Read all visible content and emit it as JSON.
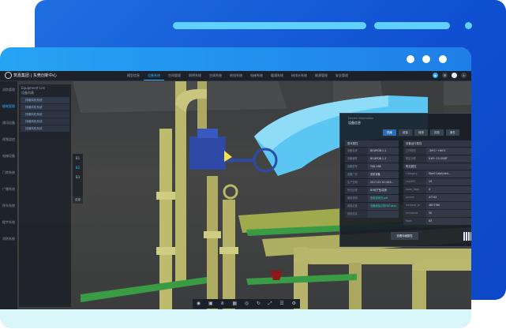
{
  "colors": {
    "back_card": "#1f6fe0",
    "front_top": "#26a4f4",
    "accent": "#2fb6ff",
    "teal_link": "#2fd3b0",
    "pipe_yellow": "#b9b76a",
    "pipe_blue": "#5cc6f2",
    "valve_blue": "#2f4aa6"
  },
  "header": {
    "brand": "筑嘉集团 | 东莞创新中心"
  },
  "nav": {
    "items": [
      "模型信息",
      "设备系统",
      "空间管理",
      "照明系统",
      "空调系统",
      "给排系统",
      "电梯系统",
      "暖通系统",
      "给排水系统",
      "能源管理",
      "安全管理"
    ],
    "active_index": 1
  },
  "toolbar_icons": [
    "notification-icon",
    "message-icon",
    "user-icon",
    "search-icon"
  ],
  "sidebar": {
    "items": [
      "消防管理",
      "能耗管理",
      "通讯设备",
      "视频监控",
      "电梯设备",
      "门禁系统",
      "广播系统",
      "停车系统",
      "楼宇系统",
      "消防系统"
    ],
    "active_index": 1
  },
  "tree": {
    "title": "Equipment List",
    "subtitle": "设备列表",
    "items": [
      "排烟风机系统",
      "排烟风机系统",
      "排烟风机系统",
      "排烟风机系统",
      "排烟风机系统"
    ],
    "selected_index": 0
  },
  "floor": {
    "items": [
      "B1",
      "B2",
      "B3"
    ],
    "active_index": 1,
    "all_label": "全部"
  },
  "info": {
    "subtitle": "Device information",
    "title": "设备信息",
    "tabs": [
      "档案",
      "维保",
      "维修",
      "巡检",
      "备件"
    ],
    "active_tab": 0,
    "left_heading": "基本属性",
    "left_rows": [
      {
        "k": "设备名称",
        "v": "B3-BFDB-1-1",
        "link": false
      },
      {
        "k": "设备编号",
        "v": "B3-BFDB-1-1",
        "link": false
      },
      {
        "k": "设备型号",
        "v": "TAD-168",
        "link": false
      },
      {
        "k": "设备厂商",
        "v": "安防设备",
        "link": false
      },
      {
        "k": "生产日期",
        "v": "2017-03-30 08:0…",
        "link": false
      },
      {
        "k": "所在区域",
        "v": "B3地下室/泵房",
        "link": false
      },
      {
        "k": "使用说明",
        "v": "查看说明书.pdf",
        "link": true
      },
      {
        "k": "维保记录",
        "v": "设备维保记录PDF.docx",
        "link": true
      },
      {
        "k": "其他信息",
        "v": "",
        "link": false
      }
    ],
    "right_heading": "设备运行属性",
    "right_rows": [
      {
        "k": "工作电压",
        "v": "-30℃~+60℃"
      },
      {
        "k": "额定功率",
        "v": "0.65~15.5%RT"
      }
    ],
    "right_heading2": "附加属性",
    "right_rows2": [
      {
        "k": "Category",
        "v": "Shell Catalyzed…"
      },
      {
        "k": "LevelID",
        "v": "19"
      },
      {
        "k": "node_flags",
        "v": "4"
      },
      {
        "k": "parent",
        "v": "47743"
      },
      {
        "k": "element_id",
        "v": "4627780"
      },
      {
        "k": "revisionId",
        "v": "50"
      },
      {
        "k": "flags",
        "v": "83"
      }
    ],
    "button": "查看详细属性"
  },
  "bottom_tools": [
    "eye-icon",
    "cube-icon",
    "share-icon",
    "grid-icon",
    "compass-icon",
    "refresh-icon",
    "expand-icon",
    "layers-icon",
    "settings-icon"
  ]
}
